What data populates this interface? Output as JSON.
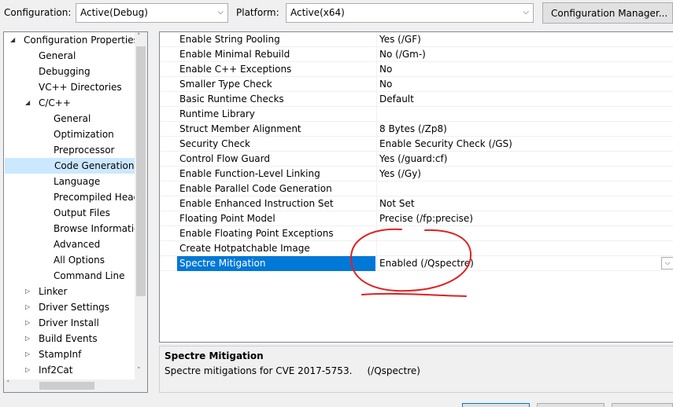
{
  "toolbar": {
    "configuration_label": "Configuration:",
    "configuration_value": "Active(Debug)",
    "platform_label": "Platform:",
    "platform_value": "Active(x64)",
    "config_manager_label": "Configuration Manager..."
  },
  "tree": {
    "items": [
      {
        "label": "Configuration Properties",
        "level": 0,
        "expanded": true,
        "twisty": "◢"
      },
      {
        "label": "General",
        "level": 1
      },
      {
        "label": "Debugging",
        "level": 1
      },
      {
        "label": "VC++ Directories",
        "level": 1
      },
      {
        "label": "C/C++",
        "level": 1,
        "expanded": true,
        "twisty": "◢"
      },
      {
        "label": "General",
        "level": 2
      },
      {
        "label": "Optimization",
        "level": 2
      },
      {
        "label": "Preprocessor",
        "level": 2
      },
      {
        "label": "Code Generation",
        "level": 2,
        "selected": true
      },
      {
        "label": "Language",
        "level": 2
      },
      {
        "label": "Precompiled Headers",
        "level": 2
      },
      {
        "label": "Output Files",
        "level": 2
      },
      {
        "label": "Browse Information",
        "level": 2
      },
      {
        "label": "Advanced",
        "level": 2
      },
      {
        "label": "All Options",
        "level": 2
      },
      {
        "label": "Command Line",
        "level": 2
      },
      {
        "label": "Linker",
        "level": 1,
        "expanded": false,
        "twisty": "▷"
      },
      {
        "label": "Driver Settings",
        "level": 1,
        "expanded": false,
        "twisty": "▷"
      },
      {
        "label": "Driver Install",
        "level": 1,
        "expanded": false,
        "twisty": "▷"
      },
      {
        "label": "Build Events",
        "level": 1,
        "expanded": false,
        "twisty": "▷"
      },
      {
        "label": "StampInf",
        "level": 1,
        "expanded": false,
        "twisty": "▷"
      },
      {
        "label": "Inf2Cat",
        "level": 1,
        "expanded": false,
        "twisty": "▷"
      }
    ]
  },
  "properties": [
    {
      "name": "Enable String Pooling",
      "value": "Yes (/GF)"
    },
    {
      "name": "Enable Minimal Rebuild",
      "value": "No (/Gm-)"
    },
    {
      "name": "Enable C++ Exceptions",
      "value": "No"
    },
    {
      "name": "Smaller Type Check",
      "value": "No"
    },
    {
      "name": "Basic Runtime Checks",
      "value": "Default"
    },
    {
      "name": "Runtime Library",
      "value": ""
    },
    {
      "name": "Struct Member Alignment",
      "value": "8 Bytes (/Zp8)"
    },
    {
      "name": "Security Check",
      "value": "Enable Security Check (/GS)"
    },
    {
      "name": "Control Flow Guard",
      "value": "Yes (/guard:cf)"
    },
    {
      "name": "Enable Function-Level Linking",
      "value": "Yes (/Gy)"
    },
    {
      "name": "Enable Parallel Code Generation",
      "value": ""
    },
    {
      "name": "Enable Enhanced Instruction Set",
      "value": "Not Set"
    },
    {
      "name": "Floating Point Model",
      "value": "Precise (/fp:precise)"
    },
    {
      "name": "Enable Floating Point Exceptions",
      "value": ""
    },
    {
      "name": "Create Hotpatchable Image",
      "value": ""
    },
    {
      "name": "Spectre Mitigation",
      "value": "Enabled (/Qspectre)",
      "selected": true
    }
  ],
  "description": {
    "title": "Spectre Mitigation",
    "text": "Spectre mitigations for CVE 2017-5753.     (/Qspectre)"
  },
  "colors": {
    "selection": "#0078d7",
    "tree_selection": "#cce8ff",
    "annotation": "#e02020"
  },
  "icons": {
    "dropdown": "chevron-down-icon",
    "scroll_up": "arrow-up-icon",
    "scroll_down": "arrow-down-icon",
    "scroll_left": "arrow-left-icon"
  }
}
